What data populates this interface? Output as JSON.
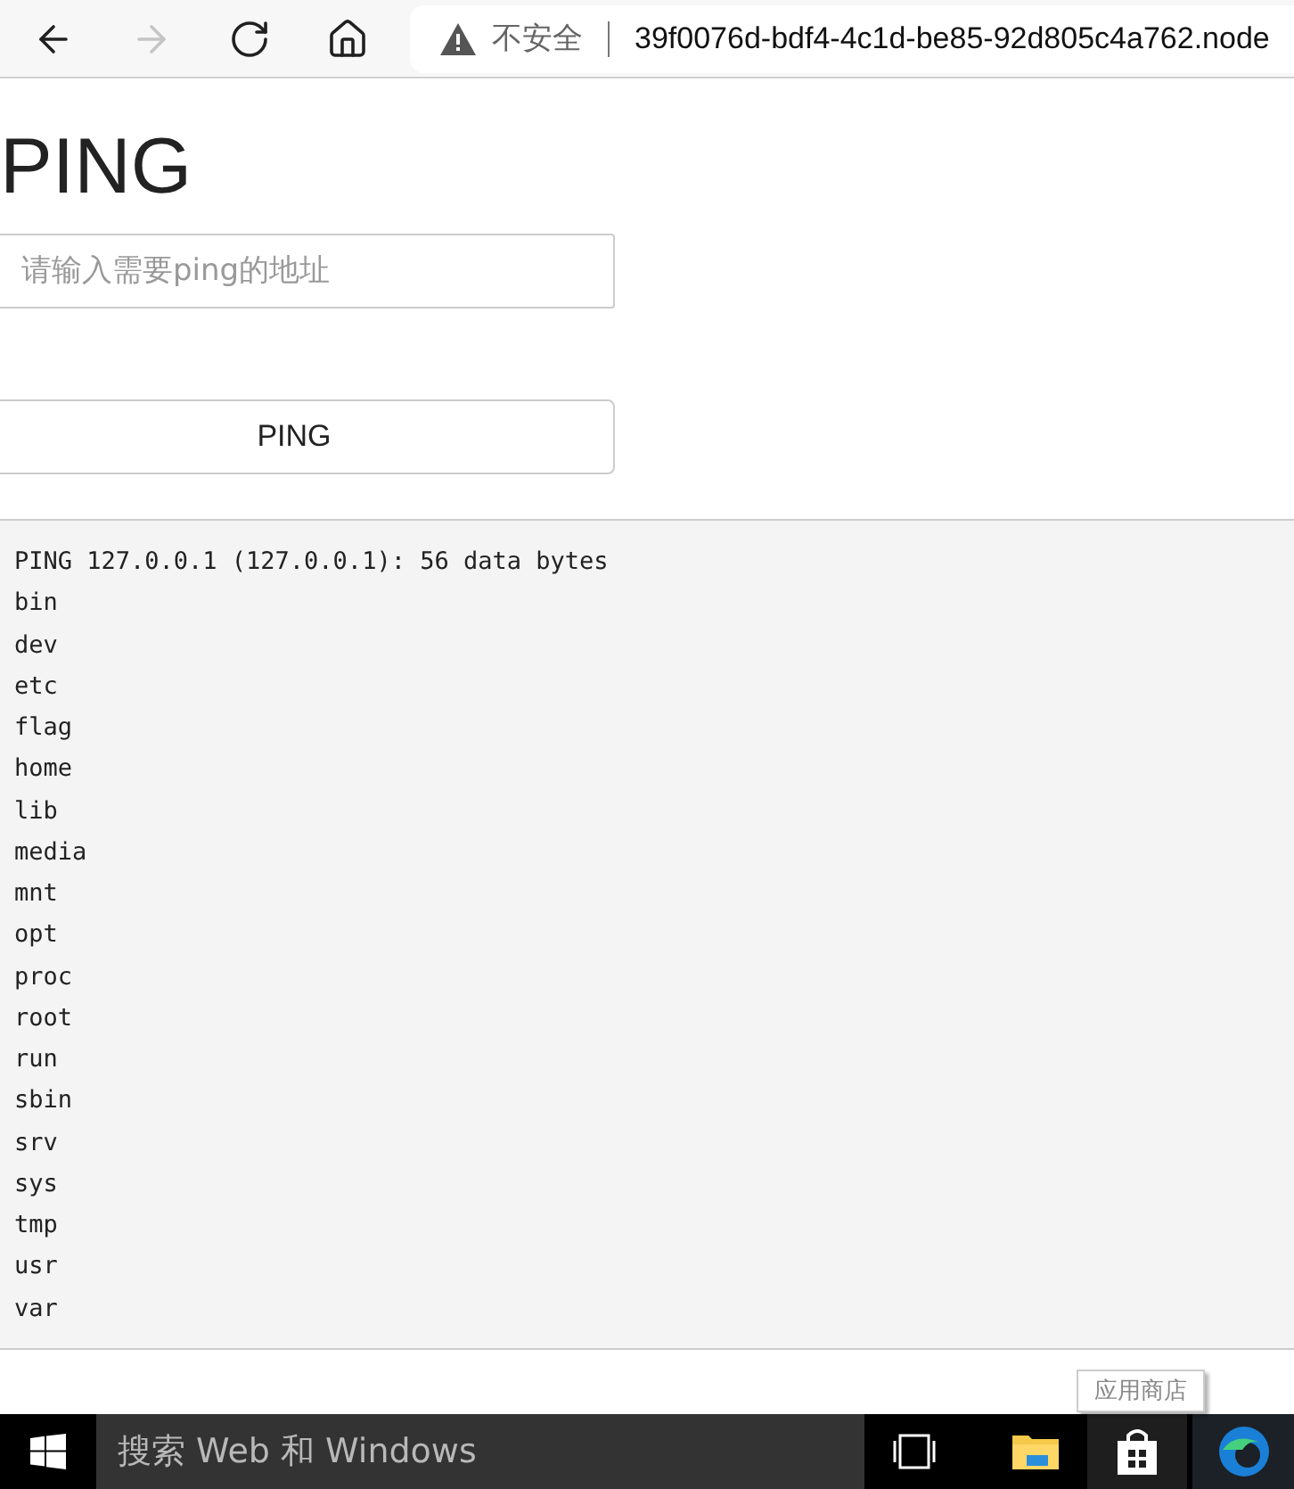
{
  "browser": {
    "nav_buttons": [
      {
        "kind": "back",
        "disabled": false
      },
      {
        "kind": "forward",
        "disabled": true
      },
      {
        "kind": "reload",
        "disabled": false
      },
      {
        "kind": "home",
        "disabled": false
      }
    ],
    "security_label": "不安全",
    "url": "39f0076d-bdf4-4c1d-be85-92d805c4a762.node"
  },
  "page": {
    "title": "PING",
    "address_field": {
      "placeholder": "请输入需要ping的地址"
    },
    "button": "PING"
  },
  "output": [
    "PING 127.0.0.1 (127.0.0.1): 56 data bytes",
    "bin",
    "dev",
    "etc",
    "flag",
    "home",
    "lib",
    "media",
    "mnt",
    "opt",
    "proc",
    "root",
    "run",
    "sbin",
    "srv",
    "sys",
    "tmp",
    "usr",
    "var"
  ],
  "taskbar": {
    "search_placeholder": "搜索 Web 和 Windows",
    "tooltip": "应用商店"
  }
}
